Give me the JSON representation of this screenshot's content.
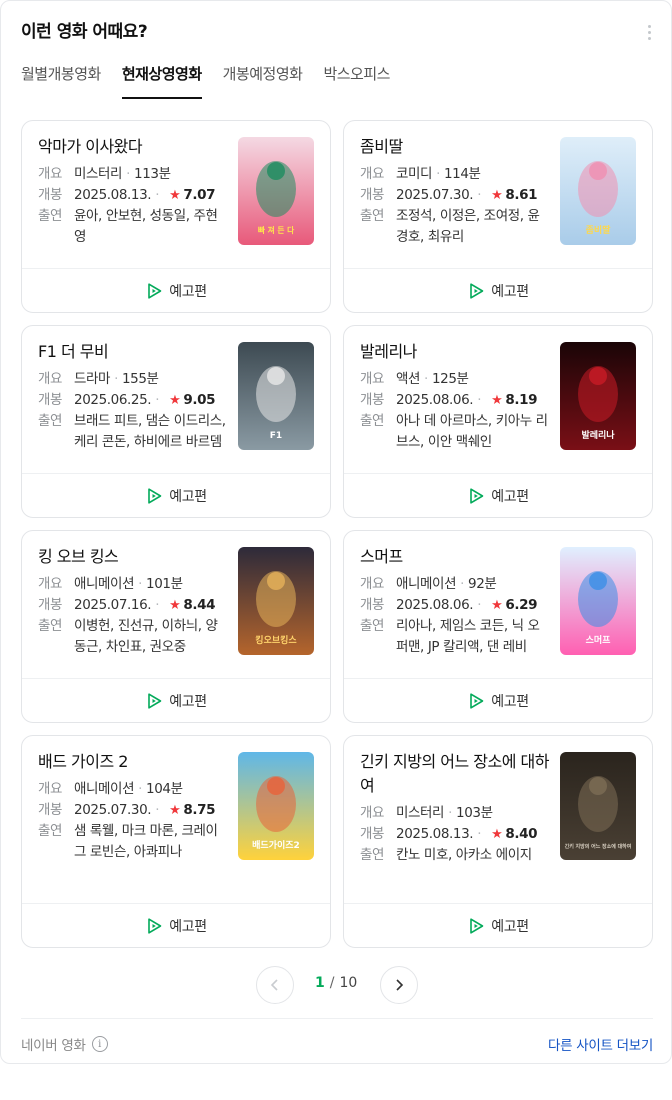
{
  "header": {
    "title": "이런 영화 어때요?",
    "more_icon": "more-vertical-icon"
  },
  "tabs": [
    {
      "label": "월별개봉영화",
      "active": false
    },
    {
      "label": "현재상영영화",
      "active": true
    },
    {
      "label": "개봉예정영화",
      "active": false
    },
    {
      "label": "박스오피스",
      "active": false
    }
  ],
  "labels": {
    "genre": "개요",
    "release": "개봉",
    "cast": "출연",
    "trailer": "예고편"
  },
  "movies": [
    {
      "title": "악마가 이사왔다",
      "genre": "미스터리",
      "runtime": "113분",
      "date": "2025.08.13.",
      "rating": "7.07",
      "cast": "윤아, 안보현, 성동일, 주현영",
      "poster_text": "빠 져 든 다"
    },
    {
      "title": "좀비딸",
      "genre": "코미디",
      "runtime": "114분",
      "date": "2025.07.30.",
      "rating": "8.61",
      "cast": "조정석, 이정은, 조여정, 윤경호, 최유리",
      "poster_text": "좀비딸"
    },
    {
      "title": "F1 더 무비",
      "genre": "드라마",
      "runtime": "155분",
      "date": "2025.06.25.",
      "rating": "9.05",
      "cast": "브래드 피트, 댐슨 이드리스, 케리 콘돈, 하비에르 바르뎀",
      "poster_text": "F1"
    },
    {
      "title": "발레리나",
      "genre": "액션",
      "runtime": "125분",
      "date": "2025.08.06.",
      "rating": "8.19",
      "cast": "아나 데 아르마스, 키아누 리브스, 이안 맥쉐인",
      "poster_text": "발레리나"
    },
    {
      "title": "킹 오브 킹스",
      "genre": "애니메이션",
      "runtime": "101분",
      "date": "2025.07.16.",
      "rating": "8.44",
      "cast": "이병헌, 진선규, 이하늬, 양동근, 차인표, 권오중",
      "poster_text": "킹오브킹스"
    },
    {
      "title": "스머프",
      "genre": "애니메이션",
      "runtime": "92분",
      "date": "2025.08.06.",
      "rating": "6.29",
      "cast": "리아나, 제임스 코든, 닉 오퍼맨, JP 칼리액, 댄 레비",
      "poster_text": "스머프"
    },
    {
      "title": "배드 가이즈 2",
      "genre": "애니메이션",
      "runtime": "104분",
      "date": "2025.07.30.",
      "rating": "8.75",
      "cast": "샘 록웰, 마크 마론, 크레이그 로빈슨, 아콰피나",
      "poster_text": "배드가이즈2"
    },
    {
      "title": "긴키 지방의 어느 장소에 대하여",
      "genre": "미스터리",
      "runtime": "103분",
      "date": "2025.08.13.",
      "rating": "8.40",
      "cast": "칸노 미호, 아카소 에이지",
      "poster_text": "긴키 지방의 어느 장소에 대하여"
    }
  ],
  "pagination": {
    "current": "1",
    "separator": "/",
    "total": "10"
  },
  "footer": {
    "source": "네이버 영화",
    "info_symbol": "i",
    "more_sites": "다른 사이트 더보기"
  },
  "colors": {
    "accent_green": "#03aa5a",
    "star_red": "#f0383b",
    "link_blue": "#1554c4"
  }
}
